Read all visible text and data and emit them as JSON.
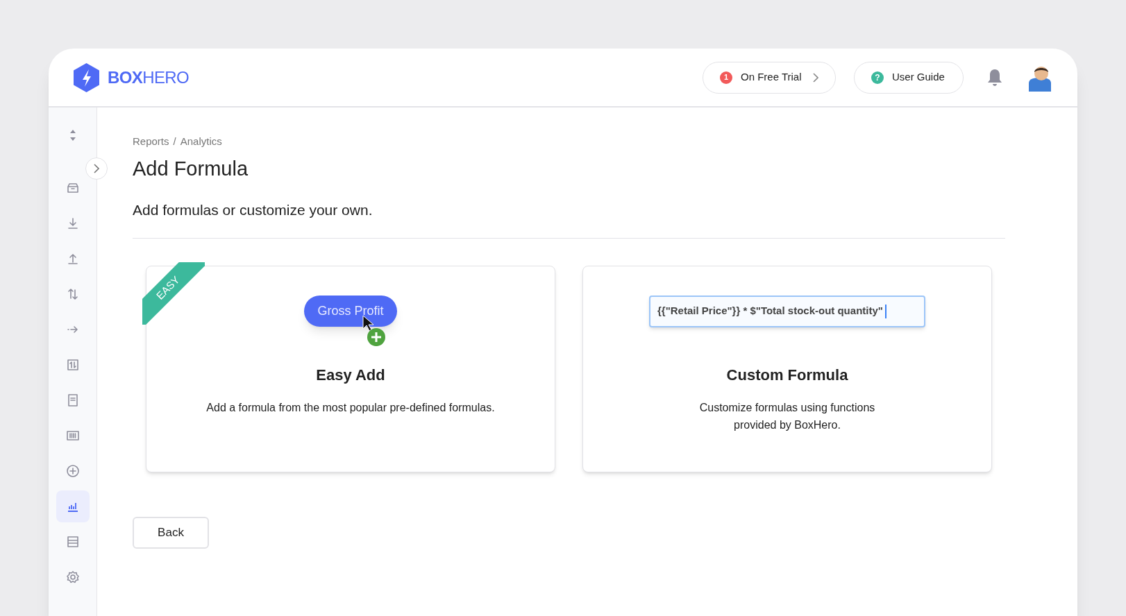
{
  "header": {
    "logo": "**BOX**HERO",
    "trial_button": {
      "badge": "1",
      "label": "On Free Trial"
    },
    "guide_button": {
      "badge": "?",
      "label": "User Guide"
    }
  },
  "sidebar": {
    "items": [
      {
        "selected": false
      },
      {
        "selected": false
      },
      {
        "selected": false
      },
      {
        "selected": false
      },
      {
        "selected": false
      },
      {
        "selected": false
      },
      {
        "selected": false
      },
      {
        "selected": false
      },
      {
        "selected": false
      },
      {
        "selected": false
      },
      {
        "selected": true
      },
      {
        "selected": false
      },
      {
        "selected": false
      }
    ]
  },
  "breadcrumb": [
    "Reports",
    "/",
    "Analytics"
  ],
  "title": "Add Formula",
  "subtitle": "Add formulas or customize your own.",
  "cards": [
    {
      "kind": "easy",
      "ribbon": "EASY",
      "chip": "Gross Profit",
      "title": "Easy Add",
      "description": "Add a formula from the most popular pre-defined formulas."
    },
    {
      "kind": "custom",
      "formula": "{{\"Retail Price\"}} * $\"Total stock-out quantity\"",
      "title": "Custom Formula",
      "description": "Customize formulas using functions provided by BoxHero."
    }
  ],
  "back_button": "Back"
}
